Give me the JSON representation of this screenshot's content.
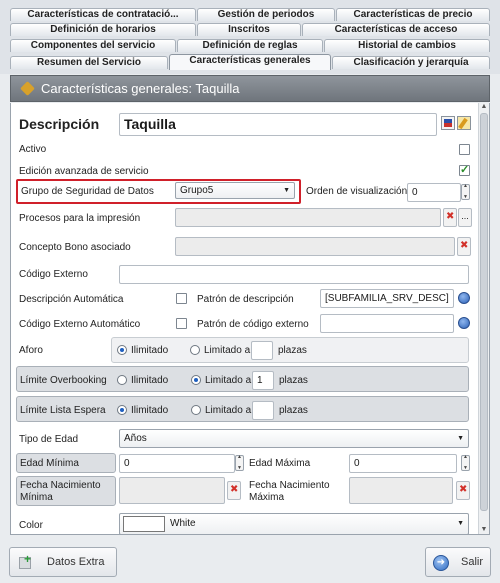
{
  "tabs": {
    "row1": [
      "Características de contratació...",
      "Gestión de periodos",
      "Características de precio"
    ],
    "row2": [
      "Definición de horarios",
      "Inscritos",
      "Características de acceso"
    ],
    "row3": [
      "Componentes del servicio",
      "Definición de reglas",
      "Historial de cambios"
    ],
    "row4": [
      "Resumen del Servicio",
      "Características generales",
      "Clasificación y jerarquía"
    ]
  },
  "title": "Características generales: Taquilla",
  "form": {
    "descripcion_label": "Descripción",
    "descripcion_value": "Taquilla",
    "activo_label": "Activo",
    "edicion_label": "Edición avanzada de servicio",
    "grupo_label": "Grupo de Seguridad de Datos",
    "grupo_value": "Grupo5",
    "orden_label": "Orden de visualización",
    "orden_value": "0",
    "procesos_label": "Procesos para la impresión",
    "concepto_label": "Concepto Bono asociado",
    "codigo_externo_label": "Código Externo",
    "desc_auto_label": "Descripción Automática",
    "patron_desc_label": "Patrón de descripción",
    "patron_desc_value": "[SUBFAMILIA_SRV_DESC]",
    "cod_auto_label": "Código Externo Automático",
    "patron_cod_label": "Patrón de código externo",
    "aforo_label": "Aforo",
    "overbooking_label": "Límite Overbooking",
    "espera_label": "Límite Lista Espera",
    "ilimitado": "Ilimitado",
    "limitado_a": "Limitado a",
    "plazas": "plazas",
    "overbooking_value": "1",
    "tipo_edad_label": "Tipo de Edad",
    "tipo_edad_value": "Años",
    "edad_min_label": "Edad Mínima",
    "edad_min_value": "0",
    "edad_max_label": "Edad Máxima",
    "edad_max_value": "0",
    "fecha_min_label_1": "Fecha Nacimiento",
    "fecha_min_label_2": "Mínima",
    "fecha_max_label_1": "Fecha Nacimiento",
    "fecha_max_label_2": "Máxima",
    "color_label": "Color",
    "color_value": "White",
    "more_button": "..."
  },
  "buttons": {
    "datos_extra": "Datos Extra",
    "salir": "Salir"
  },
  "colors": {
    "highlight": "#d0202a",
    "titlebar": "#7b8188",
    "accent": "#1f5fbf"
  }
}
